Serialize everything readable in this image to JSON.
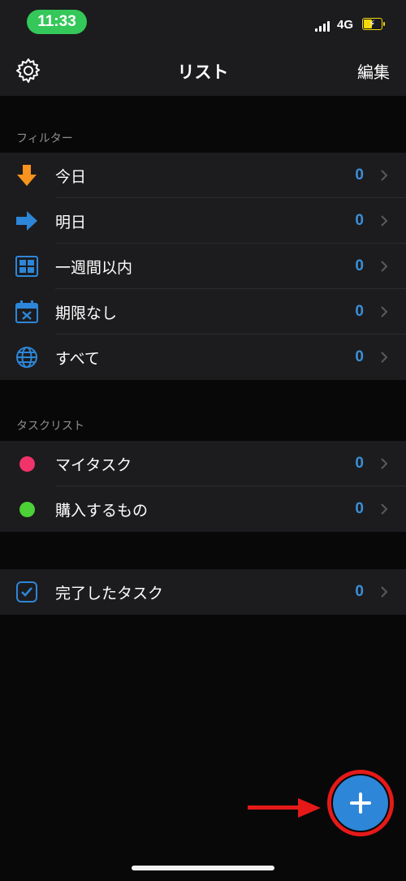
{
  "status": {
    "time": "11:33",
    "network": "4G"
  },
  "nav": {
    "title": "リスト",
    "edit_label": "編集"
  },
  "filters": {
    "header": "フィルター",
    "items": [
      {
        "label": "今日",
        "count": "0",
        "icon": "down-arrow-icon"
      },
      {
        "label": "明日",
        "count": "0",
        "icon": "right-arrow-icon"
      },
      {
        "label": "一週間以内",
        "count": "0",
        "icon": "week-grid-icon"
      },
      {
        "label": "期限なし",
        "count": "0",
        "icon": "calendar-x-icon"
      },
      {
        "label": "すべて",
        "count": "0",
        "icon": "globe-icon"
      }
    ]
  },
  "task_lists": {
    "header": "タスクリスト",
    "items": [
      {
        "label": "マイタスク",
        "count": "0",
        "color": "#f0336a"
      },
      {
        "label": "購入するもの",
        "count": "0",
        "color": "#4cd137"
      }
    ]
  },
  "completed": {
    "label": "完了したタスク",
    "count": "0",
    "icon": "checkbox-icon"
  },
  "colors": {
    "accent": "#2d86d8",
    "highlight": "#e61919",
    "count": "#3a8fd8"
  },
  "fab": {
    "icon": "plus-icon"
  }
}
